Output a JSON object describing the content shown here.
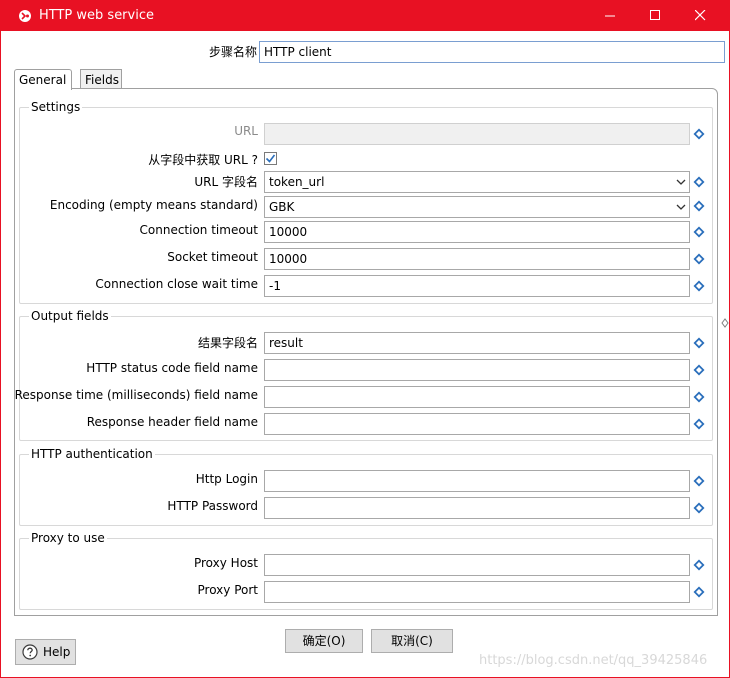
{
  "window": {
    "title": "HTTP web service",
    "controls": {
      "minimize": "minimize",
      "maximize": "maximize",
      "close": "close"
    }
  },
  "step": {
    "label": "步骤名称",
    "value": "HTTP client"
  },
  "tabs": [
    {
      "label": "General",
      "active": true
    },
    {
      "label": "Fields",
      "active": false
    }
  ],
  "settings": {
    "title": "Settings",
    "url": {
      "label": "URL",
      "value": "",
      "disabled": true
    },
    "from_field": {
      "label": "从字段中获取 URL ?",
      "checked": true
    },
    "url_field": {
      "label": "URL 字段名",
      "value": "token_url"
    },
    "encoding": {
      "label": "Encoding (empty means standard)",
      "value": "GBK"
    },
    "connection_timeout": {
      "label": "Connection timeout",
      "value": "10000"
    },
    "socket_timeout": {
      "label": "Socket timeout",
      "value": "10000"
    },
    "close_wait": {
      "label": "Connection close wait time",
      "value": "-1"
    }
  },
  "output": {
    "title": "Output fields",
    "result_field": {
      "label": "结果字段名",
      "value": "result"
    },
    "status_code": {
      "label": "HTTP status code field name",
      "value": ""
    },
    "response_time": {
      "label": "Response time (milliseconds) field name",
      "value": ""
    },
    "response_header": {
      "label": "Response header field name",
      "value": ""
    }
  },
  "auth": {
    "title": "HTTP authentication",
    "login": {
      "label": "Http Login",
      "value": ""
    },
    "password": {
      "label": "HTTP Password",
      "value": ""
    }
  },
  "proxy": {
    "title": "Proxy to use",
    "host": {
      "label": "Proxy Host",
      "value": ""
    },
    "port": {
      "label": "Proxy Port",
      "value": ""
    }
  },
  "buttons": {
    "ok": "确定(O)",
    "cancel": "取消(C)",
    "help": "Help"
  },
  "watermark": "https://blog.csdn.net/qq_39425846",
  "colors": {
    "titlebar": "#e81123",
    "variable_icon": "#2a6ebb",
    "field_border": "#a8a8a8"
  },
  "icons": {
    "variable": "diamond-dollar-icon",
    "help": "question-circle-icon",
    "app": "kettle-icon"
  }
}
